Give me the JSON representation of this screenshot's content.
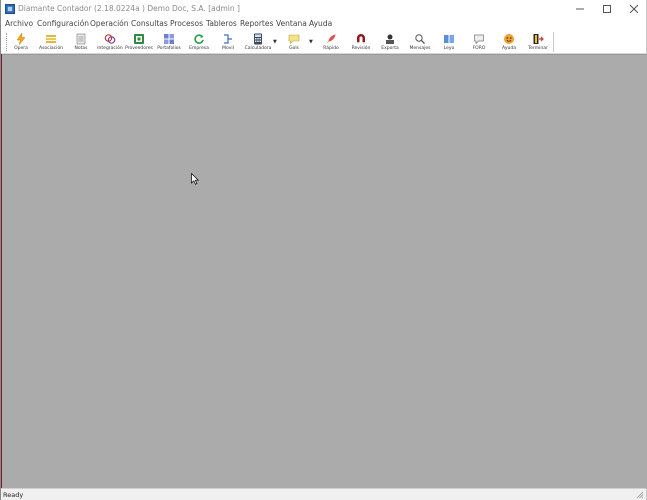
{
  "window": {
    "title": "Diamante Contador (2.18.0224a ) Demo Doc, S.A.  [admin ]"
  },
  "menu": {
    "items": [
      "Archivo",
      "Configuración",
      "Operación",
      "Consultas",
      "Procesos",
      "Tableros",
      "Reportes",
      "Ventana",
      "Ayuda"
    ]
  },
  "toolbar": {
    "buttons": [
      {
        "label": "Opera",
        "icon": "lightning-icon"
      },
      {
        "label": "Asociación",
        "icon": "list-icon"
      },
      {
        "label": "Notas",
        "icon": "document-icon"
      },
      {
        "label": "Integración",
        "icon": "integration-icon"
      },
      {
        "label": "Proveedores",
        "icon": "supplier-icon"
      },
      {
        "label": "Portafolios",
        "icon": "grid-icon"
      },
      {
        "label": "Empresa",
        "icon": "refresh-icon"
      },
      {
        "label": "Movil",
        "icon": "mobile-icon"
      },
      {
        "label": "Calculadora",
        "icon": "calculator-icon"
      },
      {
        "label": "Gols",
        "icon": "chat-icon"
      },
      {
        "label": "Rápido",
        "icon": "rocket-icon"
      },
      {
        "label": "Revisión",
        "icon": "magnet-icon"
      },
      {
        "label": "Exporta",
        "icon": "export-icon"
      },
      {
        "label": "Mensajes",
        "icon": "search-icon"
      },
      {
        "label": "Leyo",
        "icon": "book-icon"
      },
      {
        "label": "FORO",
        "icon": "forum-icon"
      },
      {
        "label": "Ayuda",
        "icon": "help-icon"
      },
      {
        "label": "Terminar",
        "icon": "exit-icon"
      }
    ]
  },
  "status": {
    "text": "Ready"
  },
  "colors": {
    "mdi_background": "#ababab",
    "title_text": "#8a8a8a"
  }
}
